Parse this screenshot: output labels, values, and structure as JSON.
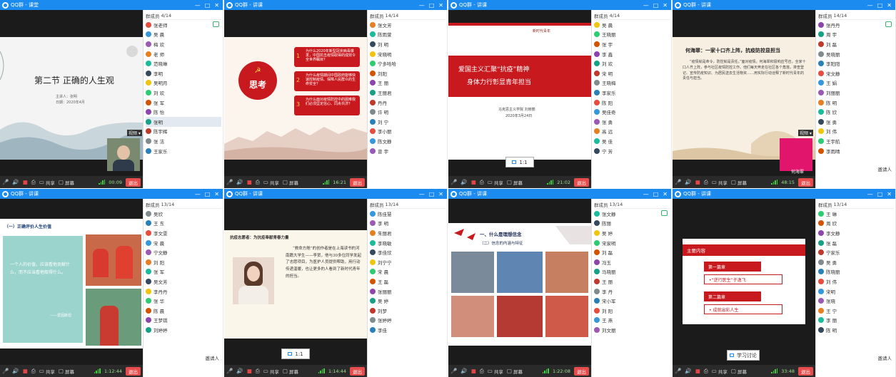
{
  "app": {
    "name": "QQ群",
    "badge_text": "思考"
  },
  "windows": [
    {
      "title": "QQ群 - 课堂",
      "panel_label": "群成员",
      "panel_count": "4/14",
      "slide": {
        "title": "第二节 正确的人生观",
        "line1": "主讲人：张明",
        "line2": "日期：2020年4月"
      },
      "time": "00:09",
      "exit": "退出",
      "members": [
        "张老师",
        "吴 晨",
        "梅 欢",
        "老 师",
        "范晓琳",
        "李明",
        "吴明月",
        "刘 欢",
        "张 军",
        "陈 怡",
        "张明",
        "陈宇辉",
        "张 洁",
        "王家乐"
      ],
      "selected": 10
    },
    {
      "title": "QQ群 - 讲课",
      "panel_label": "群成员",
      "panel_count": "14/14",
      "slide": {
        "q1": "为什么2020年新型冠状病毒爆发，中国抗击疫情取得的成效令全世界瞩目？",
        "q2": "为什么疫情期间中国政府能够快速控制疫情、保障人民群众的生命安全？",
        "q3": "为什么面对疫情防控中的困难我们必须坚定信心、同舟共济？"
      },
      "time": "16:21",
      "exit": "退出",
      "members": [
        "张文芳",
        "陈雨萱",
        "刘 明",
        "宋晓明",
        "宁多哈哈",
        "刘阳",
        "王 丽",
        "王丽君",
        "丹丹",
        "许 明",
        "刘 宁",
        "李小丽",
        "陈文静",
        "曾 宇"
      ],
      "selected": -1
    },
    {
      "title": "QQ群 - 讲课",
      "panel_label": "群成员",
      "panel_count": "4/14",
      "slide": {
        "header": "新时代青年",
        "main1": "爱国主义汇聚“抗疫”精神",
        "main2": "身体力行彰显青年担当",
        "footer1": "马克思主义学院 刘晓丽",
        "footer2": "2020年3月24日"
      },
      "ratio": "1:1",
      "time": "21:02",
      "exit": "退出",
      "members": [
        "吴 晨",
        "王晓丽",
        "张 宇",
        "李 鑫",
        "刘 欢",
        "宋 明",
        "王晓梅",
        "李家乐",
        "陈 阳",
        "吴佳奇",
        "张 勇",
        "高 远",
        "吴 佳",
        "宁 芳"
      ],
      "selected": -1
    },
    {
      "title": "QQ群 - 讲课",
      "panel_label": "群成员",
      "panel_count": "14/14",
      "slide": {
        "title": "何海翠：一家十口齐上阵，抗疫防控显担当",
        "body": "“疫情就是命令，防控就是责任。”面对疫情，何海翠积极响应号召，全家十口人齐上阵，参与社区疫情防控工作。他们每天奔走在社区各个角落，排查登记、宣传防疫知识、为居民送去生活物资……用实际行动诠释了新时代青年的责任与担当。"
      },
      "caption": "何海翠",
      "time": "48:15",
      "exit": "退出",
      "invite": "邀请人",
      "members": [
        "张丹丹",
        "周 宇",
        "刘 磊",
        "吴晓丽",
        "李阳阳",
        "宋文静",
        "王 娟",
        "刘丽丽",
        "陈 明",
        "陈 欣",
        "张 勇",
        "刘 伟",
        "王宇航",
        "李雨晴"
      ],
      "selected": -1
    },
    {
      "title": "QQ群 - 讲课",
      "panel_label": "群成员",
      "panel_count": "13/14",
      "slide": {
        "header": "（一）正确评价人生价值",
        "quote": "一个人的价值，应该看他贡献什么，而不应当看他取得什么。",
        "author": "——爱因斯坦"
      },
      "time": "1:12:44",
      "exit": "退出",
      "invite": "邀请人",
      "members": [
        "吴欣",
        "王 东",
        "李文雯",
        "宋 晨",
        "宁文静",
        "刘 阳",
        "张 军",
        "吴文芳",
        "李丹丹",
        "张 华",
        "陈 晨",
        "王梦琪",
        "刘婷婷"
      ],
      "selected": -1
    },
    {
      "title": "QQ群 - 讲课",
      "panel_label": "群成员",
      "panel_count": "13/14",
      "slide": {
        "header": "抗疫志愿者：为抗疫奉献青春力量",
        "body": "“救命方舱”的创作者是在上海读书的河南籍大学生——李贺，他与30多位同学发起了志愿项目，为医护人员提供帮助，用行动传递温暖，也让更多的人看到了新时代青年的担当。"
      },
      "ratio": "1:1",
      "time": "1:14:44",
      "exit": "退出",
      "members": [
        "陈佳慧",
        "李 明",
        "朱丽君",
        "李晓敏",
        "李佳欣",
        "刘宁宁",
        "宋 晨",
        "王 磊",
        "张丽丽",
        "吴 婷",
        "刘梦",
        "张婷婷",
        "李佳"
      ],
      "selected": -1
    },
    {
      "title": "QQ群 - 讲课",
      "panel_label": "群成员",
      "panel_count": "13/14",
      "slide": {
        "header1": "一、什么是理想信念",
        "header2": "（二）信念的内涵与特征"
      },
      "time": "1:22:08",
      "exit": "退出",
      "members": [
        "张文静",
        "陈丽",
        "吴 婷",
        "宋家明",
        "刘 磊",
        "冯玉",
        "马晓丽",
        "王 丽",
        "李 丹",
        "宋小军",
        "刘 阳",
        "王 燕",
        "刘文丽"
      ],
      "selected": -1
    },
    {
      "title": "QQ群 - 讲课",
      "panel_label": "群成员",
      "panel_count": "13/14",
      "slide": {
        "header": "主要内容",
        "section1": "第一篇章",
        "item1": "•“逆行医生”于逸飞",
        "section2": "第二篇章",
        "item2": "• 成就出彩人生"
      },
      "caption": "学习讨论",
      "time": "33:48",
      "exit": "退出",
      "invite": "邀请人",
      "members": [
        "王 琳",
        "周 欣",
        "李文静",
        "张 磊",
        "宁家乐",
        "吴 勇",
        "陈晓丽",
        "刘 伟",
        "宋明",
        "张晓",
        "王 宁",
        "李 丽",
        "陈 明"
      ],
      "selected": -1
    }
  ],
  "controls": {
    "camera": "摄像头",
    "share": "共享",
    "screen": "屏幕",
    "mic": "麦克风"
  },
  "colors": {
    "titlebar": "#1b8bf0",
    "dark_bg": "#1b1b1b",
    "party_red": "#c8191e",
    "signal_green": "#3cd13c"
  },
  "avatar_colors": [
    "#e74c3c",
    "#3498db",
    "#9b59b6",
    "#e67e22",
    "#1abc9c",
    "#34495e",
    "#f1c40f",
    "#2ecc71",
    "#d35400",
    "#8e44ad",
    "#16a085",
    "#c0392b",
    "#7f8c8d",
    "#2980b9"
  ]
}
